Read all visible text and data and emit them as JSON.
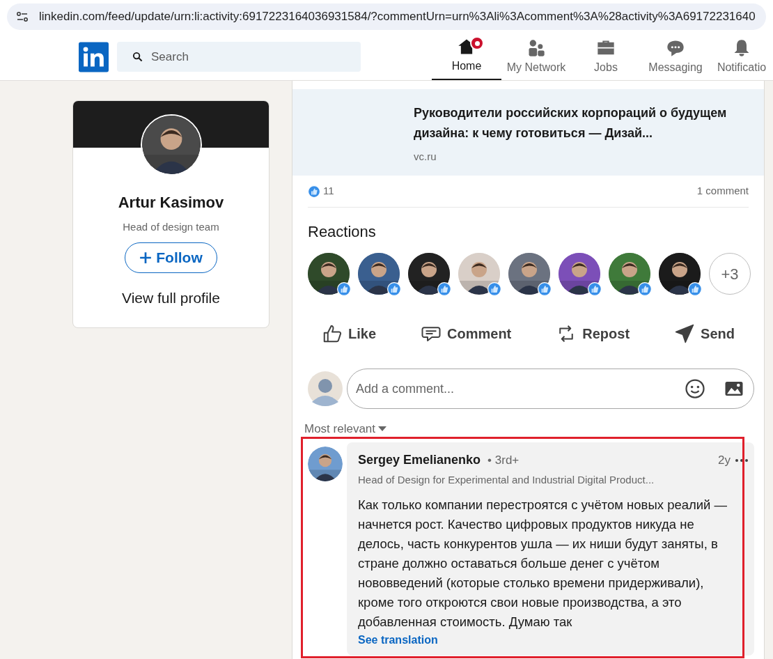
{
  "address_bar": {
    "url": "linkedin.com/feed/update/urn:li:activity:6917223164036931584/?commentUrn=urn%3Ali%3Acomment%3A%28activity%3A69172231640"
  },
  "nav": {
    "search": {
      "placeholder": "Search"
    },
    "items": [
      {
        "kind": "home",
        "label": "Home",
        "selected": true,
        "badge": true
      },
      {
        "kind": "network",
        "label": "My Network",
        "selected": false,
        "badge": false
      },
      {
        "kind": "jobs",
        "label": "Jobs",
        "selected": false,
        "badge": false
      },
      {
        "kind": "messaging",
        "label": "Messaging",
        "selected": false,
        "badge": false
      },
      {
        "kind": "bell",
        "label": "Notificatio",
        "selected": false,
        "badge": false
      }
    ]
  },
  "profile": {
    "name": "Artur Kasimov",
    "headline": "Head of design team",
    "follow": "Follow",
    "view_profile": "View full profile"
  },
  "post": {
    "preview": {
      "title": "Руководители российских корпораций о будущем дизайна: к чему готовиться — Дизай...",
      "source": "vc.ru"
    },
    "likes": "11",
    "comments_count": "1 comment",
    "reactions_title": "Reactions",
    "more_reactors": "+3",
    "reactors": [
      {
        "color": "#2f4a2a"
      },
      {
        "color": "#3a5f8f"
      },
      {
        "color": "#222222"
      },
      {
        "color": "#d9cfc8"
      },
      {
        "color": "#6b7280"
      },
      {
        "color": "#7c4fb8"
      },
      {
        "color": "#3f7a3a"
      },
      {
        "color": "#1b1b1b"
      }
    ],
    "actions": [
      {
        "kind": "like",
        "label": "Like"
      },
      {
        "kind": "comment",
        "label": "Comment"
      },
      {
        "kind": "repost",
        "label": "Repost"
      },
      {
        "kind": "send",
        "label": "Send"
      }
    ],
    "comment_box": {
      "placeholder": "Add a comment..."
    },
    "sort": "Most relevant",
    "comments": [
      {
        "author": "Sergey Emelianenko",
        "degree": "• 3rd+",
        "headline": "Head of Design for Experimental and Industrial Digital Product...",
        "time": "2y",
        "text": "Как только компании перестроятся с учётом новых реалий — начнется рост. Качество цифровых продуктов никуда не делось, часть конкурентов ушла — их ниши будут заняты, в стране должно оставаться больше денег с учётом нововведений (которые столько времени придерживали), кроме того откроются свои новые производства, а это добавленная стоимость. Думаю так",
        "translate": "See translation"
      }
    ]
  }
}
